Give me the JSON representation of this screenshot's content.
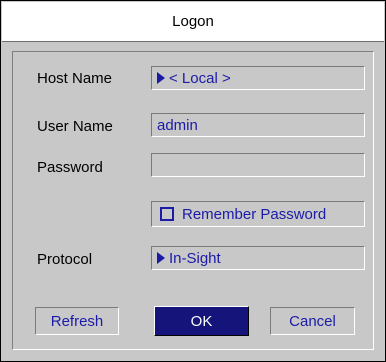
{
  "window": {
    "title": "Logon"
  },
  "form": {
    "host_name": {
      "label": "Host Name",
      "value": "< Local >"
    },
    "user_name": {
      "label": "User Name",
      "value": "admin"
    },
    "password": {
      "label": "Password",
      "value": ""
    },
    "remember_password": {
      "label": "Remember Password",
      "checked": false
    },
    "protocol": {
      "label": "Protocol",
      "value": "In-Sight"
    }
  },
  "buttons": {
    "refresh": "Refresh",
    "ok": "OK",
    "cancel": "Cancel"
  },
  "icons": {
    "dropdown": "triangle-right-icon",
    "checkbox": "checkbox-unchecked-icon"
  },
  "colors": {
    "background": "#c8c8c8",
    "accent_text": "#1b1ba8",
    "primary_button": "#14147a"
  }
}
